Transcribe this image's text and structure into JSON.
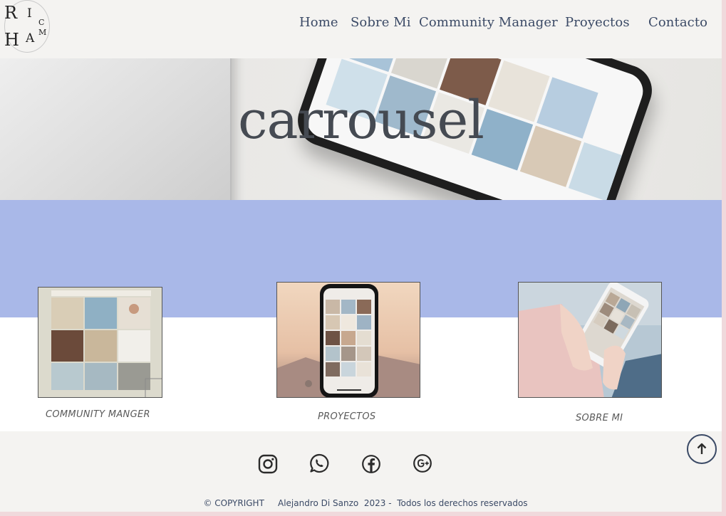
{
  "logo": {
    "letters": [
      "R",
      "I",
      "C",
      "M",
      "H",
      "A"
    ]
  },
  "nav": {
    "items": [
      {
        "label": "Home"
      },
      {
        "label": "Sobre Mi"
      },
      {
        "label": "Community Manager"
      },
      {
        "label": "Proyectos"
      },
      {
        "label": "Contacto"
      }
    ]
  },
  "hero": {
    "title": "carrousel"
  },
  "cards": [
    {
      "label": "COMMUNITY MANGER"
    },
    {
      "label": "PROYECTOS"
    },
    {
      "label": "SOBRE MI"
    }
  ],
  "footer": {
    "social_icons": [
      "instagram-icon",
      "whatsapp-icon",
      "facebook-icon",
      "google-plus-icon"
    ],
    "copyright": "© COPYRIGHT     Alejandro Di Sanzo  2023 -  Todos los derechos reservados"
  },
  "colors": {
    "nav_text": "#3b4a66",
    "band": "#a9b8e8",
    "page_bg": "#f4f3f1",
    "border": "#f0d9dc"
  }
}
